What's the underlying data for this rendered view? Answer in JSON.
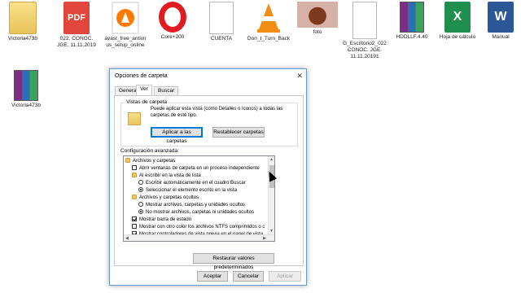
{
  "desktop": {
    "icons": [
      {
        "label": "Victoria473b",
        "icon": "folder-icon"
      },
      {
        "label": "022. CONOC. JGE. 11.11.2019",
        "icon": "pdf-icon",
        "glyph": "PDF"
      },
      {
        "label": "avast_free_antivir us_setup_online",
        "icon": "avast-icon"
      },
      {
        "label": "Core+200",
        "icon": "opera-icon"
      },
      {
        "label": "CUENTA",
        "icon": "document-icon"
      },
      {
        "label": "Don_t_Turn_Back",
        "icon": "vlc-icon"
      },
      {
        "label": "foto",
        "icon": "photo-icon"
      },
      {
        "label": "G_Escritorio2_022 CONOC. JGE. 11.11.20191",
        "icon": "document-icon"
      },
      {
        "label": "HDDLLF.4.40",
        "icon": "winrar-icon"
      },
      {
        "label": "Hoja de cálculo",
        "icon": "excel-icon",
        "glyph": "X"
      },
      {
        "label": "Manual",
        "icon": "word-icon",
        "glyph": "W"
      },
      {
        "label": "Victoria473b",
        "icon": "winrar-icon"
      }
    ]
  },
  "dialog": {
    "title": "Opciones de carpeta",
    "close": "✕",
    "tabs": [
      "General",
      "Ver",
      "Buscar"
    ],
    "active_tab": "Ver",
    "folder_views": {
      "title": "Vistas de carpeta",
      "description": "Puede aplicar esta vista (como Detalles o Iconos) a todas las carpetas de este tipo.",
      "apply_label": "Aplicar a las carpetas",
      "reset_label": "Restablecer carpetas"
    },
    "advanced": {
      "label": "Configuración avanzada:",
      "items": [
        {
          "text": "Archivos y carpetas",
          "kind": "folder",
          "indent": 0
        },
        {
          "text": "Abrir ventanas de carpeta  en un proceso independiente",
          "kind": "check",
          "checked": false,
          "indent": 1
        },
        {
          "text": "Al escribir en la vista de lista",
          "kind": "folder",
          "indent": 1
        },
        {
          "text": "Escribir automáticamente en el cuadro Buscar",
          "kind": "radio",
          "checked": false,
          "indent": 2
        },
        {
          "text": "Seleccionar el elemento escrito en la vista",
          "kind": "radio",
          "checked": true,
          "indent": 2
        },
        {
          "text": "Archivos y carpetas ocultos",
          "kind": "folder",
          "indent": 1
        },
        {
          "text": "Mostrar archivos, carpetas y unidades ocultos",
          "kind": "radio",
          "checked": false,
          "indent": 2
        },
        {
          "text": "No mostrar archivos, carpetas ni unidades ocultos",
          "kind": "radio",
          "checked": true,
          "indent": 2
        },
        {
          "text": "Mostrar barra de estado",
          "kind": "check",
          "checked": true,
          "indent": 1
        },
        {
          "text": "Mostrar con otro color los archivos NTFS comprimidos o c",
          "kind": "check",
          "checked": false,
          "indent": 1
        },
        {
          "text": "Mostrar controladores de vista previa en el panel de vista",
          "kind": "check",
          "checked": true,
          "indent": 1
        }
      ]
    },
    "restore_label": "Restaurar valores predeterminados",
    "ok_label": "Aceptar",
    "cancel_label": "Cancelar",
    "apply_label": "Aplicar"
  }
}
